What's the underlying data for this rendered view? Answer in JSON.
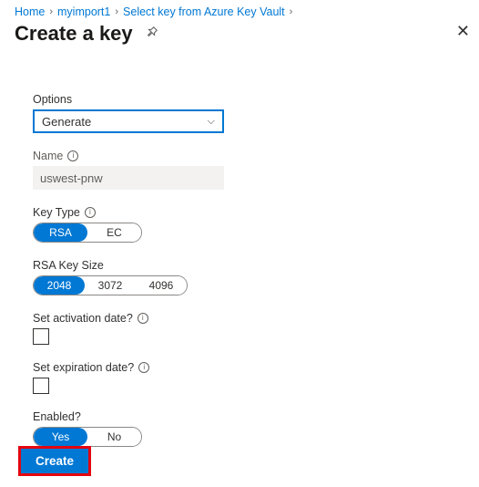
{
  "breadcrumb": {
    "home": "Home",
    "kv": "myimport1",
    "select": "Select key from Azure Key Vault"
  },
  "header": {
    "title": "Create a key"
  },
  "options": {
    "label": "Options",
    "value": "Generate"
  },
  "name": {
    "label": "Name",
    "value": "uswest-pnw"
  },
  "keyType": {
    "label": "Key Type",
    "rsa": "RSA",
    "ec": "EC"
  },
  "rsaSize": {
    "label": "RSA Key Size",
    "s1": "2048",
    "s2": "3072",
    "s3": "4096"
  },
  "activation": {
    "label": "Set activation date?"
  },
  "expiration": {
    "label": "Set expiration date?"
  },
  "enabled": {
    "label": "Enabled?",
    "yes": "Yes",
    "no": "No"
  },
  "footer": {
    "create": "Create"
  }
}
